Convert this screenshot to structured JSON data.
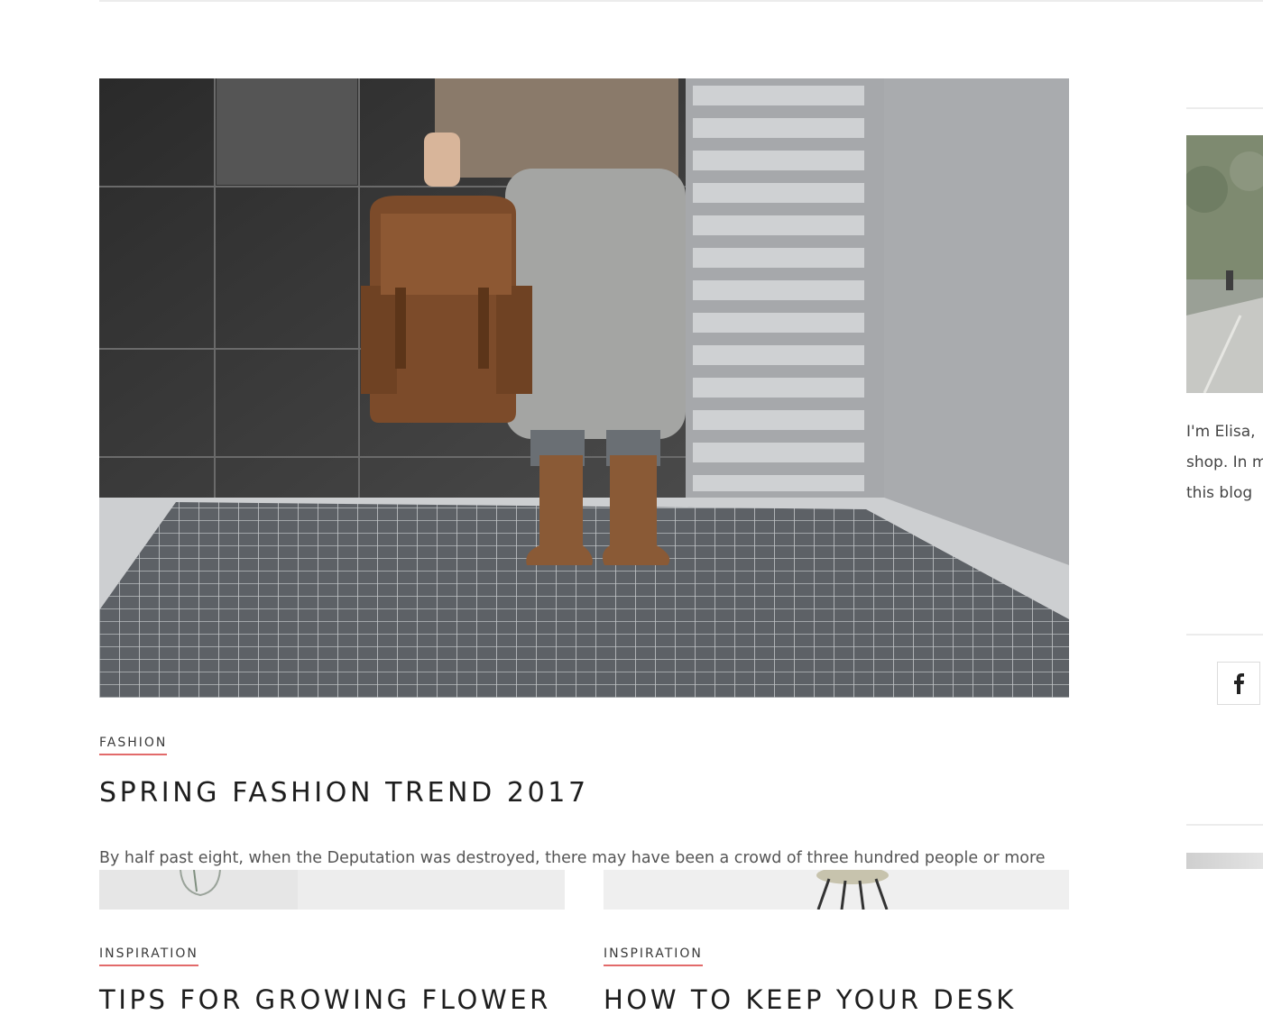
{
  "featured_post": {
    "category": "FASHION",
    "title": "SPRING FASHION TREND 2017",
    "excerpt": "By half past eight, when the Deputation was destroyed, there may have been a crowd of three hundred people or more"
  },
  "posts": [
    {
      "category": "INSPIRATION",
      "title": "TIPS FOR GROWING FLOWER"
    },
    {
      "category": "INSPIRATION",
      "title": "HOW TO KEEP YOUR DESK"
    }
  ],
  "sidebar": {
    "about_lines": [
      "I'm Elisa,",
      "shop. In m",
      "this blog"
    ],
    "social": {
      "facebook_icon": "facebook-icon"
    }
  },
  "colors": {
    "accent": "#e26a6a",
    "text": "#1e1e1e"
  }
}
